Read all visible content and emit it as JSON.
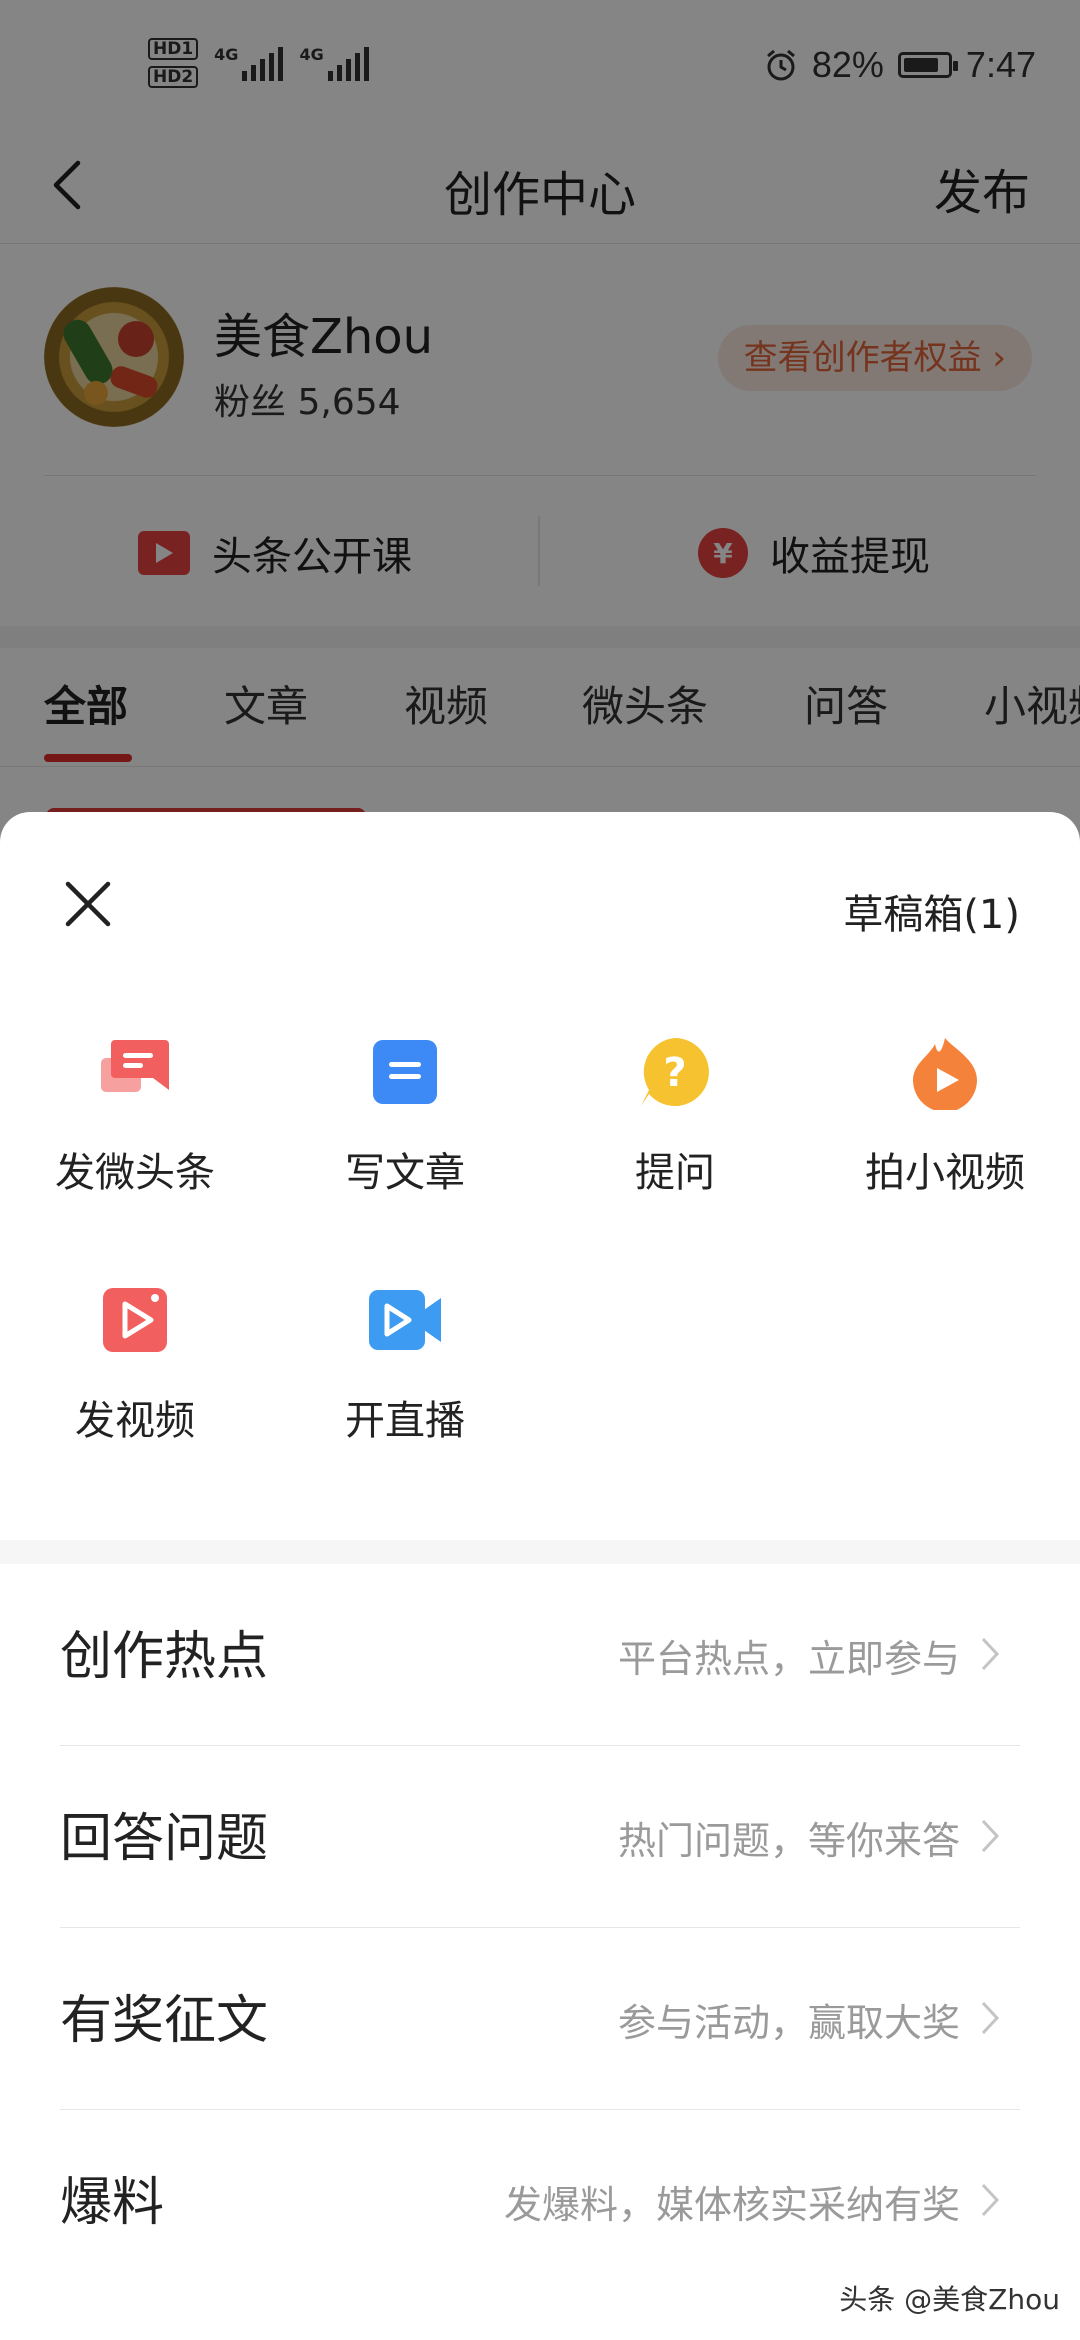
{
  "status_bar": {
    "hd1": "HD1",
    "hd2": "HD2",
    "network_1": "4G",
    "network_2": "4G",
    "battery": "82%",
    "battery_level": 0.82,
    "time": "7:47",
    "alarm_icon": "alarm-clock-icon"
  },
  "nav": {
    "title": "创作中心",
    "publish": "发布",
    "back_icon": "back-arrow-icon"
  },
  "profile": {
    "name": "美食Zhou",
    "fans_label": "粉丝",
    "fans_count": "5,654",
    "benefits_button": "查看创作者权益"
  },
  "quick_links": [
    {
      "label": "头条公开课",
      "icon": "video-play-icon"
    },
    {
      "label": "收益提现",
      "icon": "yuan-coin-icon"
    }
  ],
  "tabs": [
    "全部",
    "文章",
    "视频",
    "微头条",
    "问答",
    "小视频"
  ],
  "sheet": {
    "drafts": "草稿箱(1)",
    "create_options": [
      {
        "label": "发微头条",
        "icon": "micro-post-icon",
        "color": "#f25f5f"
      },
      {
        "label": "写文章",
        "icon": "article-icon",
        "color": "#3d8af7"
      },
      {
        "label": "提问",
        "icon": "question-icon",
        "color": "#f7c22f"
      },
      {
        "label": "拍小视频",
        "icon": "short-video-icon",
        "color": "#f5823b"
      },
      {
        "label": "发视频",
        "icon": "video-upload-icon",
        "color": "#f25f5f"
      },
      {
        "label": "开直播",
        "icon": "live-camera-icon",
        "color": "#3d9cf2"
      }
    ],
    "entries": [
      {
        "title": "创作热点",
        "desc": "平台热点，立即参与"
      },
      {
        "title": "回答问题",
        "desc": "热门问题，等你来答"
      },
      {
        "title": "有奖征文",
        "desc": "参与活动，赢取大奖"
      },
      {
        "title": "爆料",
        "desc": "发爆料，媒体核实采纳有奖"
      }
    ]
  },
  "watermark": "头条 @美食Zhou"
}
